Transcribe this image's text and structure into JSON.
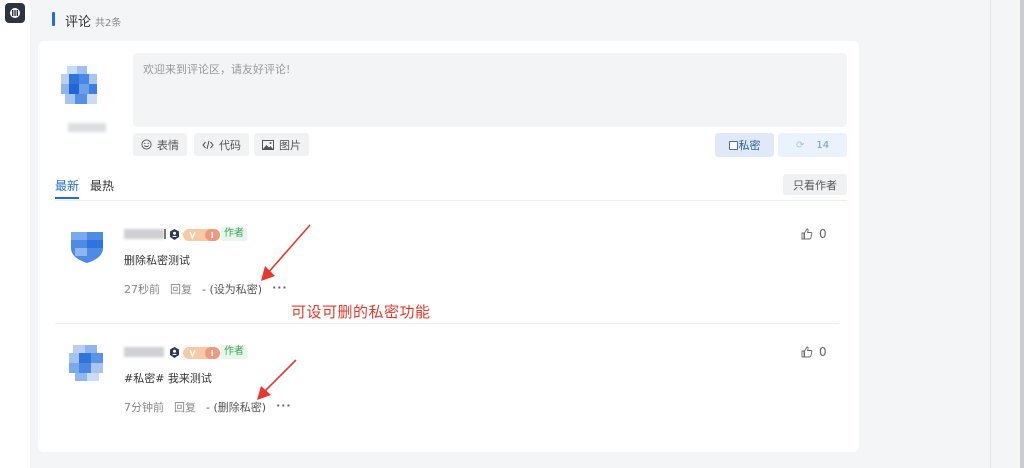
{
  "section": {
    "title": "评论",
    "count": "共2条"
  },
  "composer": {
    "placeholder": "欢迎来到评论区，请友好评论!",
    "tools": [
      {
        "label": "表情",
        "icon": "smile-icon"
      },
      {
        "label": "代码",
        "icon": "code-icon"
      },
      {
        "label": "图片",
        "icon": "image-icon"
      }
    ],
    "private_label": "私密",
    "counter": "14"
  },
  "tabs": [
    {
      "label": "最新",
      "active": true
    },
    {
      "label": "最热",
      "active": false
    }
  ],
  "author_only_label": "只看作者",
  "comments": [
    {
      "author_tag": "作者",
      "content": "删除私密测试",
      "time": "27秒前",
      "reply": "回复",
      "private_action": "- (设为私密)",
      "more": "···",
      "likes": "0"
    },
    {
      "author_tag": "作者",
      "content": "#私密# 我来测试",
      "time": "7分钟前",
      "reply": "回复",
      "private_action": "- (删除私密)",
      "more": "···",
      "likes": "0"
    }
  ],
  "annotation": "可设可删的私密功能",
  "colors": {
    "accent": "#1e6fd9",
    "annotation_red": "#e8382c",
    "author_tag_green": "#3aa55a"
  }
}
